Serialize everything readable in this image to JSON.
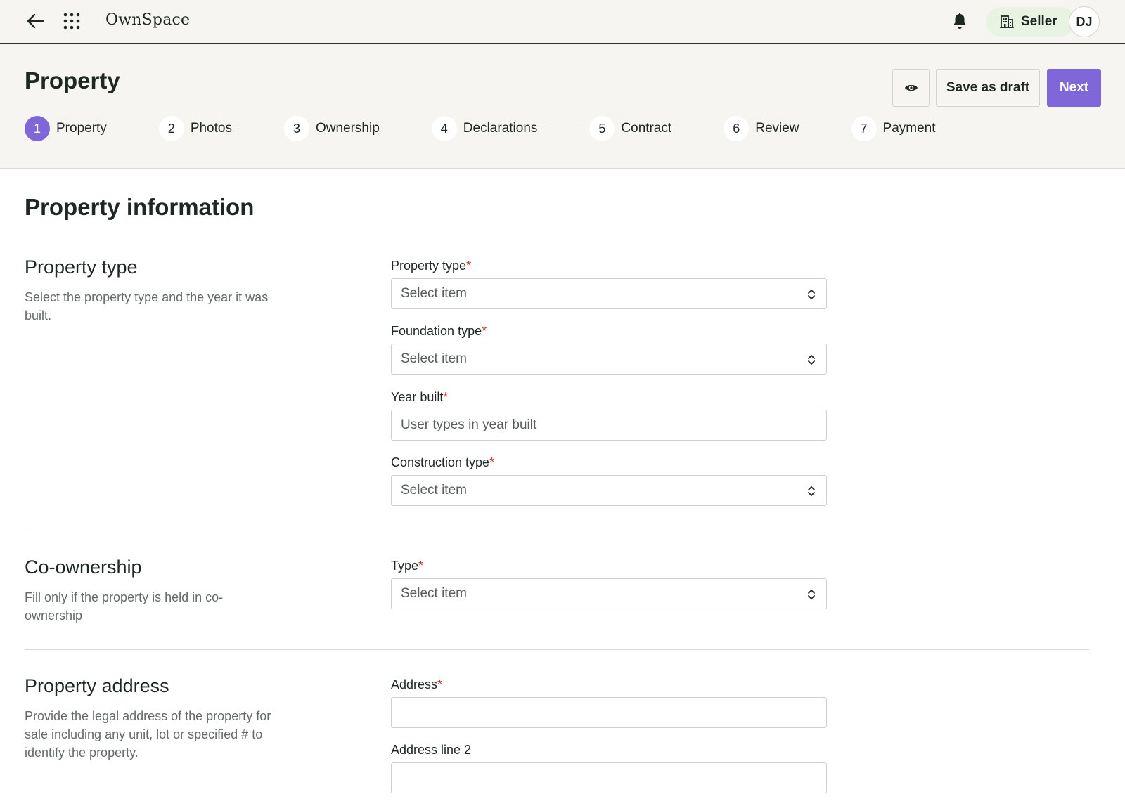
{
  "app": {
    "name": "OwnSpace"
  },
  "topbar": {
    "role_label": "Seller",
    "avatar_initials": "DJ"
  },
  "header": {
    "title": "Property",
    "save_draft_label": "Save as draft",
    "next_label": "Next",
    "steps": [
      {
        "num": "1",
        "label": "Property"
      },
      {
        "num": "2",
        "label": "Photos"
      },
      {
        "num": "3",
        "label": "Ownership"
      },
      {
        "num": "4",
        "label": "Declarations"
      },
      {
        "num": "5",
        "label": "Contract"
      },
      {
        "num": "6",
        "label": "Review"
      },
      {
        "num": "7",
        "label": "Payment"
      }
    ],
    "active_step": 1
  },
  "main": {
    "section_title": "Property information",
    "property_type": {
      "heading": "Property type",
      "description": "Select the property type and the year it was built.",
      "fields": {
        "property_type": {
          "label": "Property type",
          "placeholder": "Select item"
        },
        "foundation_type": {
          "label": "Foundation type",
          "placeholder": "Select item"
        },
        "year_built": {
          "label": "Year built",
          "placeholder": "User types in year built"
        },
        "construction_type": {
          "label": "Construction type",
          "placeholder": "Select item"
        }
      }
    },
    "co_ownership": {
      "heading": "Co-ownership",
      "description": "Fill only if the property is held in co-ownership",
      "fields": {
        "type": {
          "label": "Type",
          "placeholder": "Select item"
        }
      }
    },
    "property_address": {
      "heading": "Property address",
      "description": "Provide the legal address of the property for sale including any unit, lot or specified # to identify the property.",
      "fields": {
        "address": {
          "label": "Address",
          "value": ""
        },
        "address_line_2": {
          "label": "Address line 2",
          "value": ""
        }
      }
    }
  },
  "required_marker": "*",
  "colors": {
    "accent": "#7f67da",
    "required": "#d12f2f",
    "role_pill": "#e8f3e3",
    "header_bg": "#f6f5f2"
  },
  "icons": [
    "arrow-left-icon",
    "apps-grid-icon",
    "bell-icon",
    "building-icon",
    "eye-icon",
    "chevron-up-down-icon"
  ]
}
